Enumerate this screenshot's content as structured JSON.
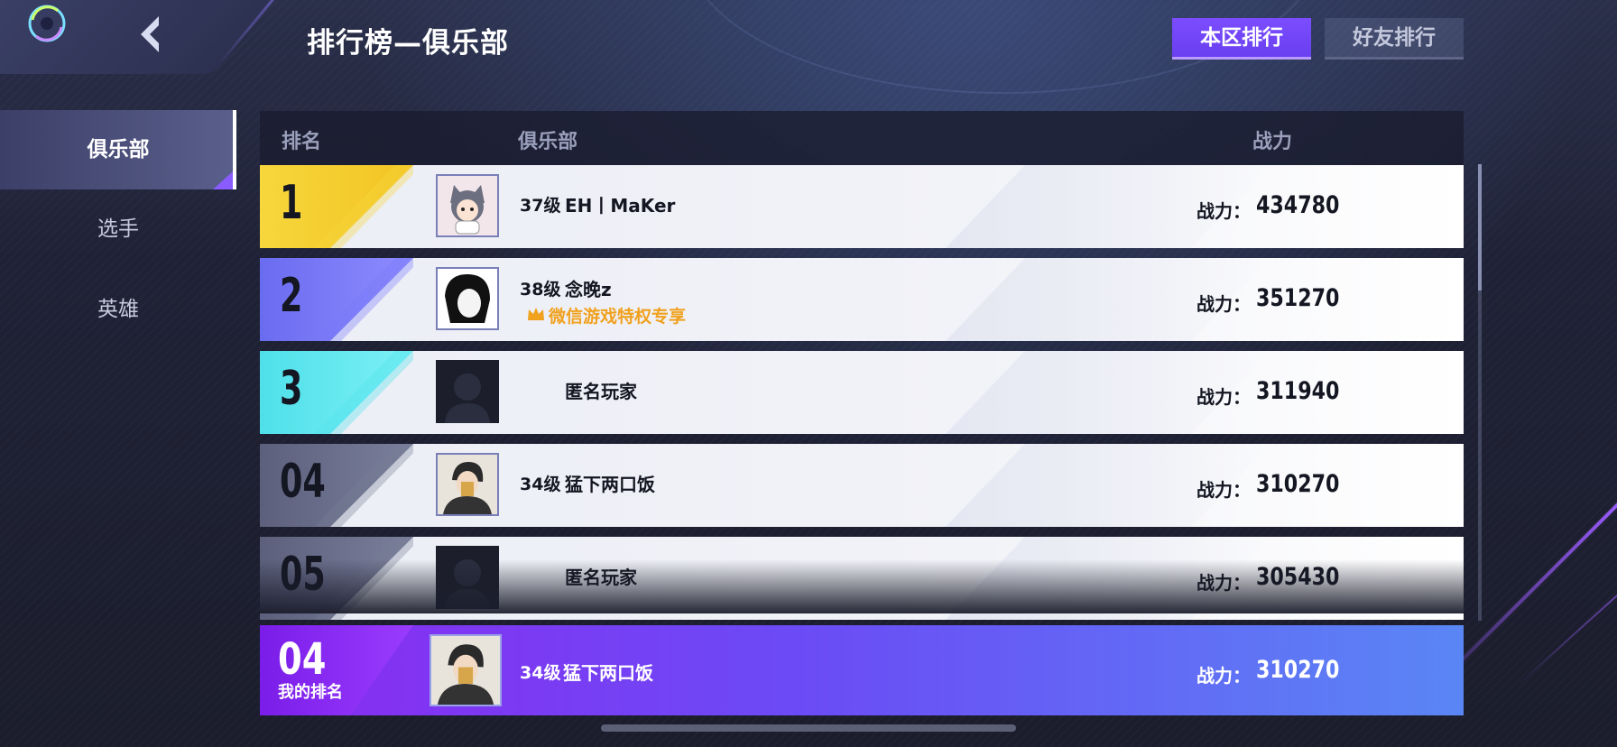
{
  "header": {
    "title": "排行榜—俱乐部",
    "back_icon": "chevron-left-icon",
    "logo_icon": "game-logo-icon"
  },
  "top_tabs": [
    {
      "label": "本区排行",
      "active": true
    },
    {
      "label": "好友排行",
      "active": false
    }
  ],
  "sidebar": {
    "items": [
      {
        "label": "俱乐部",
        "active": true
      },
      {
        "label": "选手",
        "active": false
      },
      {
        "label": "英雄",
        "active": false
      }
    ]
  },
  "table": {
    "columns": [
      "排名",
      "俱乐部",
      "战力"
    ],
    "rows": [
      {
        "rank": "1",
        "level": "37级",
        "name": "EH丨MaKer",
        "privilege": "",
        "power_label": "战力：",
        "power": "434780"
      },
      {
        "rank": "2",
        "level": "38级",
        "name": "念晚z",
        "privilege": "微信游戏特权专享",
        "power_label": "战力：",
        "power": "351270"
      },
      {
        "rank": "3",
        "level": "",
        "name": "匿名玩家",
        "privilege": "",
        "power_label": "战力：",
        "power": "311940"
      },
      {
        "rank": "04",
        "level": "34级",
        "name": "猛下两口饭",
        "privilege": "",
        "power_label": "战力：",
        "power": "310270"
      },
      {
        "rank": "05",
        "level": "",
        "name": "匿名玩家",
        "privilege": "",
        "power_label": "战力：",
        "power": "305430"
      }
    ]
  },
  "my_rank": {
    "rank": "04",
    "label": "我的排名",
    "level": "34级",
    "name": "猛下两口饭",
    "power_label": "战力：",
    "power": "310270"
  },
  "colors": {
    "accent": "#7b4dff",
    "gold": "#f3d23a",
    "privilege": "#f0a11e"
  }
}
